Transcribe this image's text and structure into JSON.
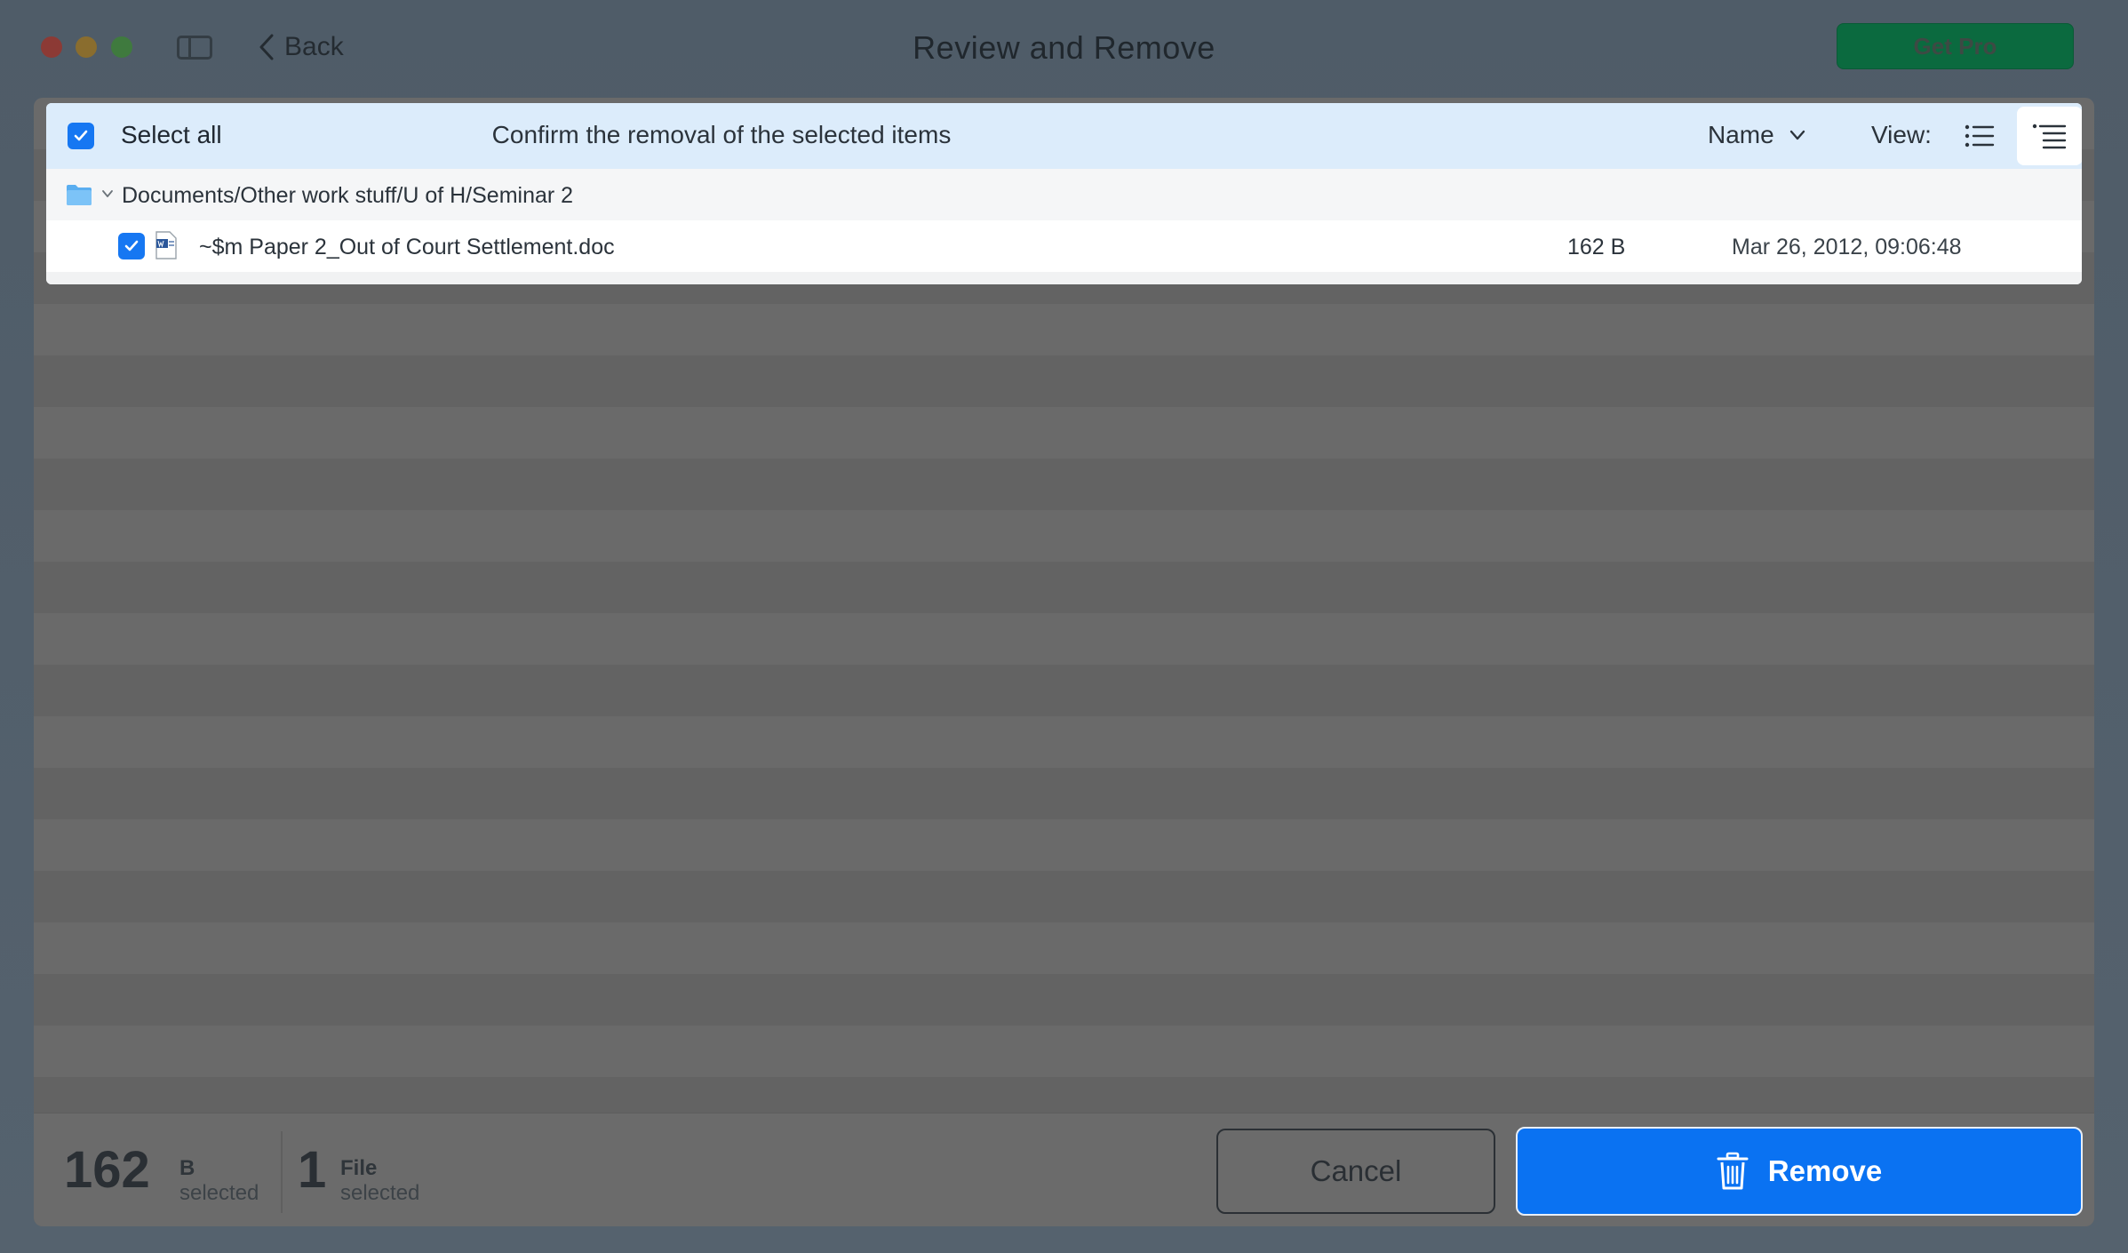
{
  "titlebar": {
    "back_label": "Back",
    "title": "Review and Remove",
    "get_pro_label": "Get Pro"
  },
  "list_header": {
    "select_all_label": "Select all",
    "message": "Confirm the removal of the selected items",
    "sort_label": "Name",
    "view_label": "View:"
  },
  "folder": {
    "path": "Documents/Other work stuff/U of H/Seminar 2",
    "files": [
      {
        "name": "~$m Paper 2_Out of Court Settlement.doc",
        "size": "162 B",
        "date": "Mar 26, 2012, 09:06:48",
        "checked": true
      }
    ]
  },
  "footer": {
    "size_value": "162",
    "size_unit": "B",
    "size_sub": "selected",
    "count_value": "1",
    "count_unit": "File",
    "count_sub": "selected",
    "cancel_label": "Cancel",
    "remove_label": "Remove"
  },
  "colors": {
    "accent": "#0a72f2",
    "pro_green": "#0b6a3f",
    "header_bg": "#dcecfb"
  }
}
